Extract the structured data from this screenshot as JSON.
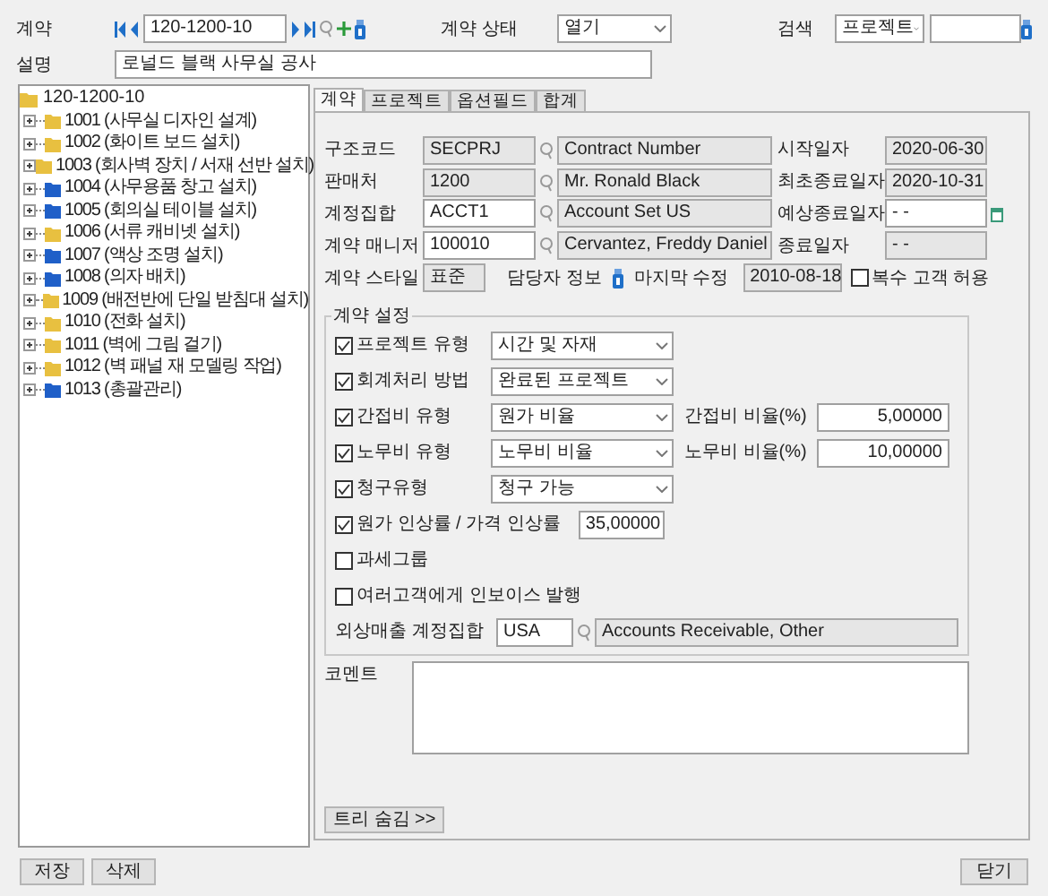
{
  "header": {
    "contract_label": "계약",
    "contract_value": "120-1200-10",
    "status_label": "계약 상태",
    "status_value": "열기",
    "search_label": "검색",
    "search_option": "프로젝트",
    "description_label": "설명",
    "description_value": "로널드 블랙 사무실 공사"
  },
  "tree": {
    "label": "120-1200-10",
    "children": [
      {
        "label": "1001 (사무실 디자인 설계)",
        "color": "#e8c040",
        "expanded": false
      },
      {
        "label": "1002 (화이트 보드 설치)",
        "color": "#e8c040",
        "expanded": false
      },
      {
        "label": "1003 (회사벽 장치 / 서재 선반 설치)",
        "color": "#e8c040",
        "expanded": false
      },
      {
        "label": "1004 (사무용품 창고 설치)",
        "color": "#1f5fc8",
        "expanded": false
      },
      {
        "label": "1005 (회의실 테이블 설치)",
        "color": "#1f5fc8",
        "expanded": false
      },
      {
        "label": "1006 (서류 캐비넷 설치)",
        "color": "#e8c040",
        "expanded": false
      },
      {
        "label": "1007 (액상 조명 설치)",
        "color": "#1f5fc8",
        "expanded": false
      },
      {
        "label": "1008 (의자 배치)",
        "color": "#1f5fc8",
        "expanded": false
      },
      {
        "label": "1009 (배전반에 단일 받침대 설치)",
        "color": "#e8c040",
        "expanded": false
      },
      {
        "label": "1010 (전화 설치)",
        "color": "#e8c040",
        "expanded": false
      },
      {
        "label": "1011 (벽에 그림 걸기)",
        "color": "#e8c040",
        "expanded": false
      },
      {
        "label": "1012 (벽 패널 재 모델링 작업)",
        "color": "#e8c040",
        "expanded": false
      },
      {
        "label": "1013 (총괄관리)",
        "color": "#1f5fc8",
        "expanded": false
      }
    ]
  },
  "tabs": [
    {
      "label": "계약",
      "selected": true
    },
    {
      "label": "프로젝트",
      "selected": false
    },
    {
      "label": "옵션필드",
      "selected": false
    },
    {
      "label": "합계",
      "selected": false
    }
  ],
  "fields": [
    {
      "label": "구조코드",
      "code": "SECPRJ",
      "code_editable": false,
      "name": "Contract Number",
      "right_label": "시작일자",
      "right_value": "2020-06-30",
      "right_editable": false
    },
    {
      "label": "판매처",
      "code": "1200",
      "code_editable": false,
      "name": "Mr. Ronald Black",
      "right_label": "최초종료일자",
      "right_value": "2020-10-31",
      "right_editable": false
    },
    {
      "label": "계정집합",
      "code": "ACCT1",
      "code_editable": true,
      "name": "Account Set US",
      "right_label": "예상종료일자",
      "right_value": "- -",
      "right_editable": true
    },
    {
      "label": "계약 매니저",
      "code": "100010",
      "code_editable": true,
      "name": "Cervantez, Freddy Daniel",
      "right_label": "종료일자",
      "right_value": "- -",
      "right_editable": false
    }
  ],
  "style_row": {
    "label": "계약 스타일",
    "value": "표준",
    "contact_label": "담당자 정보",
    "modified_label": "마지막 수정",
    "modified_value": "2010-08-18",
    "multi_customer": {
      "label": "복수 고객 허용",
      "checked": false
    }
  },
  "settings": {
    "title": "계약 설정",
    "items": [
      {
        "kind": "select",
        "label": "프로젝트 유형",
        "checked": true,
        "value": "시간 및 자재"
      },
      {
        "kind": "select",
        "label": "회계처리 방법",
        "checked": true,
        "value": "완료된 프로젝트"
      },
      {
        "kind": "select",
        "label": "간접비 유형",
        "checked": true,
        "value": "원가 비율",
        "rate_label": "간접비 비율(%)",
        "rate_value": "5,00000"
      },
      {
        "kind": "select",
        "label": "노무비 유형",
        "checked": true,
        "value": "노무비 비율",
        "rate_label": "노무비 비율(%)",
        "rate_value": "10,00000"
      },
      {
        "kind": "select",
        "label": "청구유형",
        "checked": true,
        "value": "청구 가능"
      },
      {
        "kind": "number",
        "label": "원가 인상률 / 가격 인상률",
        "checked": true,
        "value": "35,00000"
      },
      {
        "kind": "check",
        "label": "과세그룹",
        "checked": false
      },
      {
        "kind": "check",
        "label": "여러고객에게 인보이스 발행",
        "checked": false
      },
      {
        "kind": "lookup",
        "label": "외상매출 계정집합",
        "value": "USA",
        "name": "Accounts Receivable, Other"
      }
    ]
  },
  "comment_label": "코멘트",
  "tree_toggle": "트리 숨김 >>",
  "footer": {
    "save": "저장",
    "delete": "삭제",
    "close": "닫기"
  }
}
